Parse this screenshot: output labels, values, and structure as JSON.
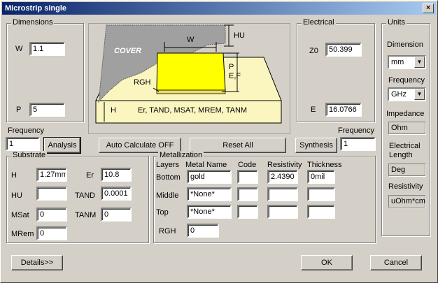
{
  "window": {
    "title": "Microstrip single",
    "close_glyph": "×"
  },
  "dimensions": {
    "title": "Dimensions",
    "w_label": "W",
    "w_value": "1.1",
    "p_label": "P",
    "p_value": "5"
  },
  "diagram": {
    "cover": "COVER",
    "w": "W",
    "hu": "HU",
    "p": "P",
    "ef": "E,F",
    "rgh": "RGH",
    "h": "H",
    "substrate_text": "Er, TAND, MSAT, MREM, TANM"
  },
  "electrical": {
    "title": "Electrical",
    "z0_label": "Z0",
    "z0_value": "50.399",
    "e_label": "E",
    "e_value": "16.0766"
  },
  "units": {
    "title": "Units",
    "dimension_label": "Dimension",
    "dimension_value": "mm",
    "frequency_label": "Frequency",
    "frequency_value": "GHz",
    "impedance_label": "Impedance",
    "impedance_value": "Ohm",
    "elec_length_label_1": "Electrical",
    "elec_length_label_2": "Length",
    "elec_length_value": "Deg",
    "resistivity_label": "Resistivity",
    "resistivity_value": "uOhm*cm"
  },
  "frequency_left": {
    "label": "Frequency",
    "value": "1"
  },
  "frequency_right": {
    "label": "Frequency",
    "value": "1"
  },
  "buttons": {
    "analysis": "Analysis",
    "auto_calc": "Auto Calculate OFF",
    "reset": "Reset  All",
    "synthesis": "Synthesis",
    "details": "Details>>",
    "ok": "OK",
    "cancel": "Cancel"
  },
  "substrate": {
    "title": "Substrate",
    "h_label": "H",
    "h_value": "1.27mm",
    "er_label": "Er",
    "er_value": "10.8",
    "hu_label": "HU",
    "hu_value": "",
    "tand_label": "TAND",
    "tand_value": "0.0001",
    "msat_label": "MSat",
    "msat_value": "0",
    "tanm_label": "TANM",
    "tanm_value": "0",
    "mrem_label": "MRem",
    "mrem_value": "0"
  },
  "metallization": {
    "title": "Metallization",
    "headers": [
      "Layers",
      "Metal Name",
      "Code",
      "Resistivity",
      "Thickness"
    ],
    "rows": [
      {
        "layer": "Bottom",
        "name": "gold",
        "code": "",
        "resistivity": "2.4390",
        "thickness": "0mil"
      },
      {
        "layer": "Middle",
        "name": "*None*",
        "code": "",
        "resistivity": "",
        "thickness": ""
      },
      {
        "layer": "Top",
        "name": "*None*",
        "code": "",
        "resistivity": "",
        "thickness": ""
      }
    ],
    "rgh_label": "RGH",
    "rgh_value": "0"
  }
}
